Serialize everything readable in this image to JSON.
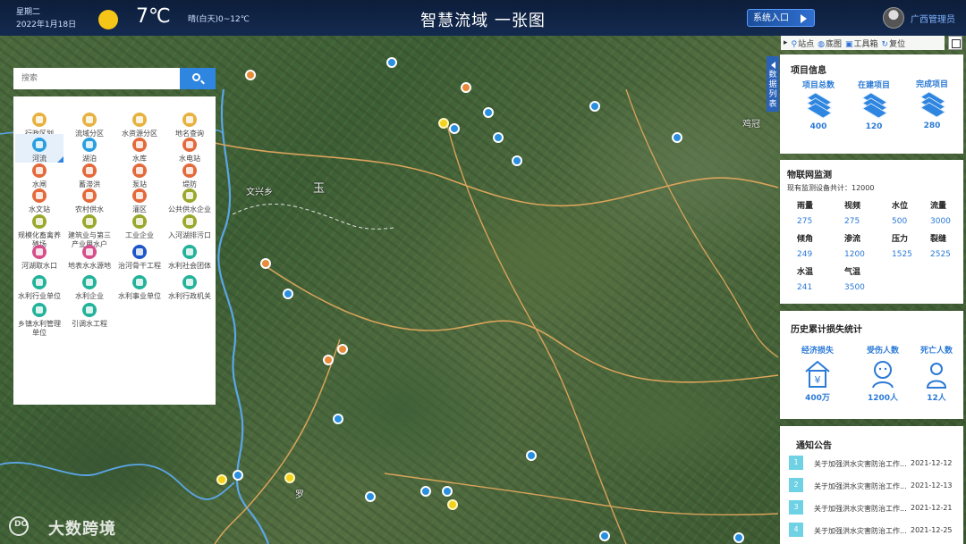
{
  "header": {
    "weekday": "星期二",
    "date": "2022年1月18日",
    "temperature": "7℃",
    "weather": "晴(白天)0~12℃",
    "title": "智慧流域 一张图",
    "system_entry_label": "系统入口",
    "user_name": "广西管理员",
    "weather_icon": "sun-icon"
  },
  "toolbar": {
    "items": [
      {
        "label": "站点",
        "icon": "site-icon"
      },
      {
        "label": "底图",
        "icon": "globe-icon"
      },
      {
        "label": "工具箱",
        "icon": "toolbox-icon"
      },
      {
        "label": "复位",
        "icon": "reset-icon"
      }
    ],
    "fullscreen_icon": "fullscreen-icon"
  },
  "search": {
    "placeholder": "搜索",
    "value": ""
  },
  "layers": [
    {
      "label": "行政区划",
      "color": "#e7b240",
      "icon": "region-icon"
    },
    {
      "label": "流域分区",
      "color": "#e7b240",
      "icon": "basin-icon"
    },
    {
      "label": "水资源分区",
      "color": "#e7b240",
      "icon": "water-resource-icon"
    },
    {
      "label": "地名查询",
      "color": "#e7b240",
      "icon": "place-icon"
    },
    {
      "label": "河流",
      "color": "#2b9fe0",
      "icon": "river-icon",
      "selected": true
    },
    {
      "label": "湖泊",
      "color": "#2b9fe0",
      "icon": "lake-icon"
    },
    {
      "label": "水库",
      "color": "#e46a3c",
      "icon": "reservoir-icon"
    },
    {
      "label": "水电站",
      "color": "#e46a3c",
      "icon": "hydropower-icon"
    },
    {
      "label": "水闸",
      "color": "#e46a3c",
      "icon": "sluice-icon"
    },
    {
      "label": "蓄滞洪",
      "color": "#e46a3c",
      "icon": "flood-storage-icon"
    },
    {
      "label": "泵站",
      "color": "#e46a3c",
      "icon": "pump-icon"
    },
    {
      "label": "堤防",
      "color": "#e46a3c",
      "icon": "dike-icon"
    },
    {
      "label": "水文站",
      "color": "#e46a3c",
      "icon": "hydrology-station-icon"
    },
    {
      "label": "农村供水",
      "color": "#e46a3c",
      "icon": "rural-water-icon"
    },
    {
      "label": "灌区",
      "color": "#e46a3c",
      "icon": "irrigation-icon"
    },
    {
      "label": "公共供水企业",
      "color": "#9aa82c",
      "icon": "public-water-icon"
    },
    {
      "label": "规模化畜禽养殖场",
      "color": "#9aa82c",
      "icon": "livestock-icon"
    },
    {
      "label": "建筑业与第三产业用水户",
      "color": "#9aa82c",
      "icon": "construction-icon"
    },
    {
      "label": "工业企业",
      "color": "#9aa82c",
      "icon": "industry-icon"
    },
    {
      "label": "入河湖排污口",
      "color": "#9aa82c",
      "icon": "outfall-icon"
    },
    {
      "label": "河湖取水口",
      "color": "#d64f8c",
      "icon": "intake-icon"
    },
    {
      "label": "地表水水源地",
      "color": "#d64f8c",
      "icon": "water-source-icon"
    },
    {
      "label": "治河骨干工程",
      "color": "#1e56c8",
      "icon": "river-project-icon"
    },
    {
      "label": "水利社会团体",
      "color": "#23b39a",
      "icon": "society-icon"
    },
    {
      "label": "水利行业单位",
      "color": "#23b39a",
      "icon": "industry-unit-icon"
    },
    {
      "label": "水利企业",
      "color": "#23b39a",
      "icon": "water-enterprise-icon"
    },
    {
      "label": "水利事业单位",
      "color": "#23b39a",
      "icon": "public-unit-icon"
    },
    {
      "label": "水利行政机关",
      "color": "#23b39a",
      "icon": "admin-icon"
    },
    {
      "label": "乡镇水利管理单位",
      "color": "#23b39a",
      "icon": "township-icon"
    },
    {
      "label": "引调水工程",
      "color": "#23b39a",
      "icon": "diversion-icon"
    }
  ],
  "data_tab": {
    "chars": [
      "数",
      "据",
      "列",
      "表"
    ]
  },
  "project_info": {
    "title": "项目信息",
    "items": [
      {
        "label": "项目总数",
        "value": "400",
        "icon": "layers-icon"
      },
      {
        "label": "在建项目",
        "value": "120",
        "icon": "layers-icon"
      },
      {
        "label": "完成项目",
        "value": "280",
        "icon": "layers-icon"
      }
    ]
  },
  "iot": {
    "title": "物联网监测",
    "subtitle": "现有监测设备共计：12000",
    "items": [
      {
        "label": "雨量",
        "value": "275"
      },
      {
        "label": "视频",
        "value": "275"
      },
      {
        "label": "水位",
        "value": "500"
      },
      {
        "label": "流量",
        "value": "3000"
      },
      {
        "label": "倾角",
        "value": "249"
      },
      {
        "label": "渗流",
        "value": "1200"
      },
      {
        "label": "压力",
        "value": "1525"
      },
      {
        "label": "裂缝",
        "value": "2525"
      },
      {
        "label": "水温",
        "value": "241"
      },
      {
        "label": "气温",
        "value": "3500"
      }
    ]
  },
  "loss": {
    "title": "历史累计损失统计",
    "items": [
      {
        "label": "经济损失",
        "value": "400万",
        "icon": "economic-loss-icon"
      },
      {
        "label": "受伤人数",
        "value": "1200人",
        "icon": "injured-icon"
      },
      {
        "label": "死亡人数",
        "value": "12人",
        "icon": "death-icon"
      }
    ]
  },
  "notice": {
    "title": "通知公告",
    "items": [
      {
        "num": "1",
        "text": "关于加强洪水灾害防治工作...",
        "date": "2021-12-12"
      },
      {
        "num": "2",
        "text": "关于加强洪水灾害防治工作...",
        "date": "2021-12-13"
      },
      {
        "num": "3",
        "text": "关于加强洪水灾害防治工作...",
        "date": "2021-12-21"
      },
      {
        "num": "4",
        "text": "关于加强洪水灾害防治工作...",
        "date": "2021-12-25"
      }
    ]
  },
  "map": {
    "labels": [
      "文兴乡",
      "玉",
      "鸡冠",
      "罗"
    ]
  },
  "watermark": {
    "text": "大数跨境",
    "logo_text": "DO"
  },
  "colors": {
    "header_bg": "#0d1d3a",
    "accent": "#2b7ad6",
    "search_button": "#2f86e0",
    "notice_badge": "#6fd1e4"
  }
}
